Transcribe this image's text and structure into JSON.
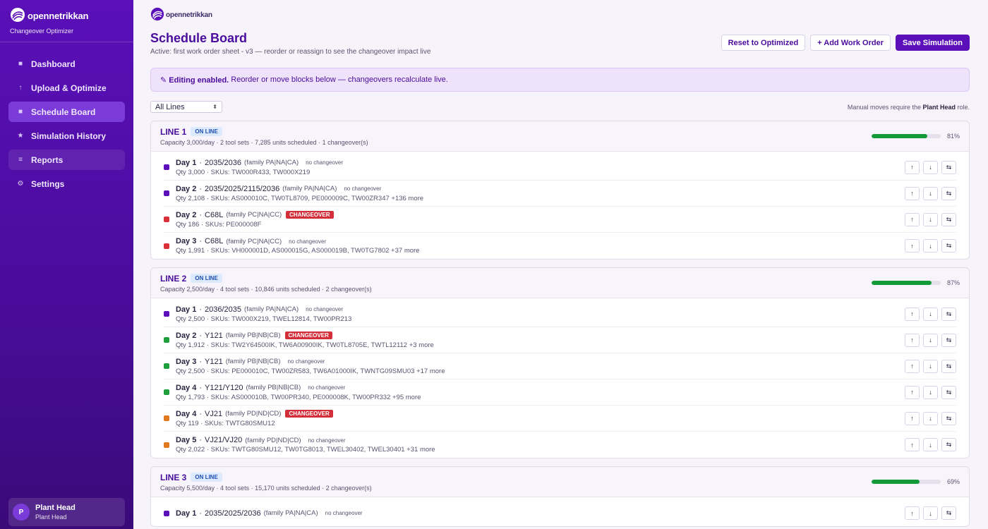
{
  "brand": {
    "name": "opennetrikkan",
    "subtitle": "Changeover Optimizer"
  },
  "nav": [
    {
      "label": "Dashboard",
      "icon": "grid-icon",
      "glyph": "■",
      "state": ""
    },
    {
      "label": "Upload & Optimize",
      "icon": "upload-icon",
      "glyph": "↑",
      "state": ""
    },
    {
      "label": "Schedule Board",
      "icon": "board-icon",
      "glyph": "■",
      "state": "active"
    },
    {
      "label": "Simulation History",
      "icon": "star-icon",
      "glyph": "★",
      "state": ""
    },
    {
      "label": "Reports",
      "icon": "list-icon",
      "glyph": "≡",
      "state": "soft"
    },
    {
      "label": "Settings",
      "icon": "gear-icon",
      "glyph": "⚙",
      "state": ""
    }
  ],
  "user": {
    "initial": "P",
    "name": "Plant Head",
    "role": "Plant Head"
  },
  "page": {
    "title": "Schedule Board",
    "subtitle": "Active: first work order sheet - v3 — reorder or reassign to see the changeover impact live"
  },
  "actions": {
    "reset": "Reset to Optimized",
    "add": "+ Add Work Order",
    "save": "Save Simulation"
  },
  "banner": {
    "strong": "✎ Editing enabled.",
    "text": " Reorder or move blocks below — changeovers recalculate live."
  },
  "filter": {
    "value": "All Lines",
    "note_prefix": "Manual moves require the ",
    "note_role": "Plant Head",
    "note_suffix": " role."
  },
  "buttons": {
    "up": "↑",
    "down": "↓",
    "swap": "⇆"
  },
  "labels": {
    "no_changeover": "no changeover",
    "changeover": "CHANGEOVER",
    "on_line": "ON LINE"
  },
  "colors": {
    "purple": "#5a0fb8",
    "red": "#d9303a",
    "green": "#1e9e3c",
    "orange": "#e07a1f"
  },
  "lines": [
    {
      "title": "LINE 1",
      "status": "ON LINE",
      "meta": "Capacity 3,000/day · 2 tool sets · 7,285 units scheduled · 1 changeover(s)",
      "util": 81,
      "util_label": "81%",
      "orders": [
        {
          "day": "Day 1",
          "code": "2035/2036",
          "family": "(family PA|NA|CA)",
          "changeover": false,
          "color": "#5a0fb8",
          "detail": "Qty 3,000 · SKUs: TW000R433, TW000X219"
        },
        {
          "day": "Day 2",
          "code": "2035/2025/2115/2036",
          "family": "(family PA|NA|CA)",
          "changeover": false,
          "color": "#5a0fb8",
          "detail": "Qty 2,108 · SKUs: AS000010C, TW0TL8709, PE000009C, TW00ZR347 +136 more"
        },
        {
          "day": "Day 2",
          "code": "C68L",
          "family": "(family PC|NA|CC)",
          "changeover": true,
          "color": "#d9303a",
          "detail": "Qty 186 · SKUs: PE000008F"
        },
        {
          "day": "Day 3",
          "code": "C68L",
          "family": "(family PC|NA|CC)",
          "changeover": false,
          "color": "#d9303a",
          "detail": "Qty 1,991 · SKUs: VH000001D, AS000015G, AS000019B, TW0TG7802 +37 more"
        }
      ]
    },
    {
      "title": "LINE 2",
      "status": "ON LINE",
      "meta": "Capacity 2,500/day · 4 tool sets · 10,846 units scheduled · 2 changeover(s)",
      "util": 87,
      "util_label": "87%",
      "orders": [
        {
          "day": "Day 1",
          "code": "2036/2035",
          "family": "(family PA|NA|CA)",
          "changeover": false,
          "color": "#5a0fb8",
          "detail": "Qty 2,500 · SKUs: TW000X219, TWEL12814, TW00PR213"
        },
        {
          "day": "Day 2",
          "code": "Y121",
          "family": "(family PB|NB|CB)",
          "changeover": true,
          "color": "#1e9e3c",
          "detail": "Qty 1,912 · SKUs: TW2Y64500IK, TW6A00900IK, TW0TL8705E, TWTL12112 +3 more"
        },
        {
          "day": "Day 3",
          "code": "Y121",
          "family": "(family PB|NB|CB)",
          "changeover": false,
          "color": "#1e9e3c",
          "detail": "Qty 2,500 · SKUs: PE000010C, TW00ZR583, TW6A01000IK, TWNTG09SMU03 +17 more"
        },
        {
          "day": "Day 4",
          "code": "Y121/Y120",
          "family": "(family PB|NB|CB)",
          "changeover": false,
          "color": "#1e9e3c",
          "detail": "Qty 1,793 · SKUs: AS000010B, TW00PR340, PE000008K, TW00PR332 +95 more"
        },
        {
          "day": "Day 4",
          "code": "VJ21",
          "family": "(family PD|ND|CD)",
          "changeover": true,
          "color": "#e07a1f",
          "detail": "Qty 119 · SKUs: TWTG80SMU12"
        },
        {
          "day": "Day 5",
          "code": "VJ21/VJ20",
          "family": "(family PD|ND|CD)",
          "changeover": false,
          "color": "#e07a1f",
          "detail": "Qty 2,022 · SKUs: TWTG80SMU12, TW0TG8013, TWEL30402, TWEL30401 +31 more"
        }
      ]
    },
    {
      "title": "LINE 3",
      "status": "ON LINE",
      "meta": "Capacity 5,500/day · 4 tool sets · 15,170 units scheduled · 2 changeover(s)",
      "util": 69,
      "util_label": "69%",
      "orders": [
        {
          "day": "Day 1",
          "code": "2035/2025/2036",
          "family": "(family PA|NA|CA)",
          "changeover": false,
          "color": "#5a0fb8",
          "detail": ""
        }
      ]
    }
  ]
}
